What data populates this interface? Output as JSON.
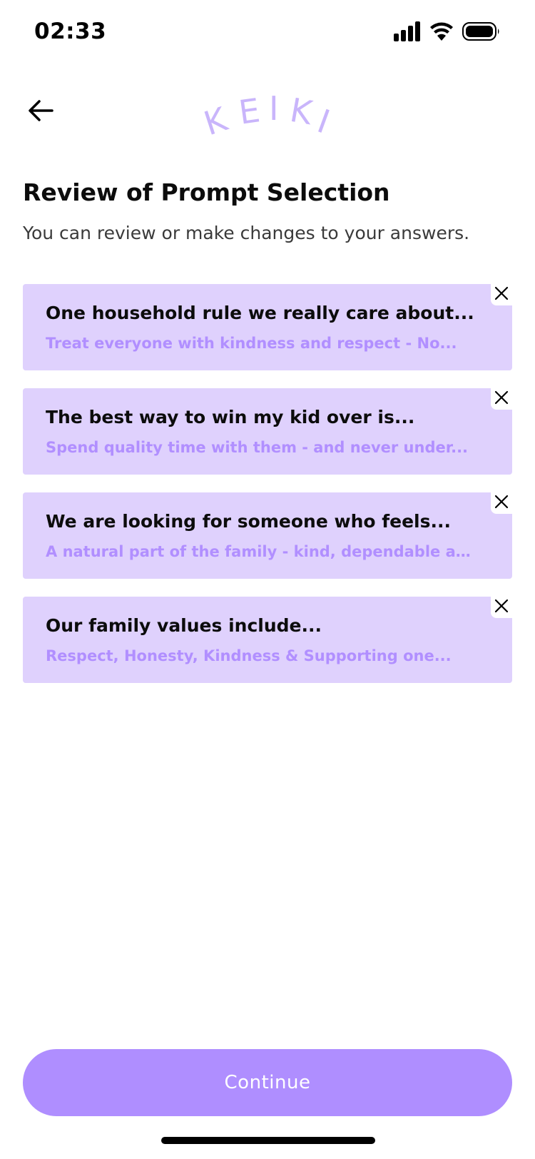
{
  "status_bar": {
    "time": "02:33",
    "icons": [
      "signal-icon",
      "wifi-icon",
      "battery-icon"
    ]
  },
  "header": {
    "back_icon": "arrow-left-icon",
    "logo_text": "KEIKI"
  },
  "page": {
    "title": "Review of Prompt Selection",
    "subtitle": "You can review or make changes to your answers."
  },
  "prompts": [
    {
      "question": "One household rule we really care about...",
      "answer": "Treat everyone with kindness and respect - No..."
    },
    {
      "question": "The best way to win my kid over is...",
      "answer": "Spend quality time with them - and never under..."
    },
    {
      "question": "We are looking for someone who feels...",
      "answer": "A natural part of the family - kind, dependable and..."
    },
    {
      "question": "Our family values include...",
      "answer": "Respect, Honesty, Kindness & Supporting one..."
    }
  ],
  "remove_icon": "close-icon",
  "footer": {
    "continue_label": "Continue"
  },
  "colors": {
    "card_background": "#dfd1fd",
    "answer_text": "#b18fff",
    "button_background": "#af8eff",
    "logo": "#c9b5fb"
  }
}
